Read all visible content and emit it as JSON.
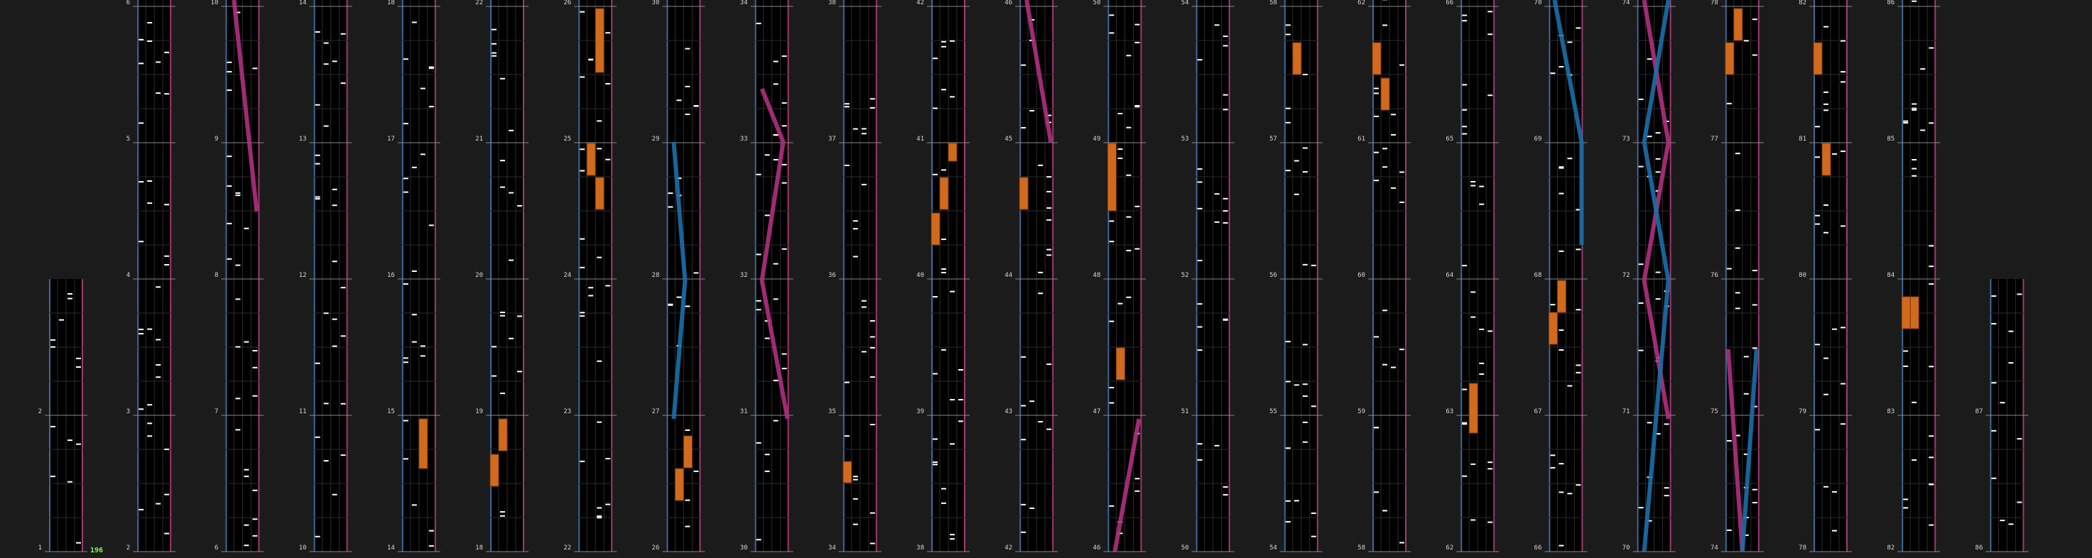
{
  "level_label": "196",
  "colors": {
    "background": "#1b1b1b",
    "lane_bg": "#000000",
    "lane_grid": "#2c2c2c",
    "lane_border_left": "#3d6a9a",
    "lane_border_right": "#a03a72",
    "note": "#ffffff",
    "hold": "#d26a1e",
    "slide_blue": "#1a6fa8",
    "slide_pink": "#b0307f"
  },
  "columns": [
    {
      "measures": [
        2,
        1
      ],
      "bottom": true
    },
    {
      "measures": [
        6,
        5,
        4,
        3,
        2
      ]
    },
    {
      "measures": [
        10,
        9,
        8,
        7,
        6
      ]
    },
    {
      "measures": [
        14,
        13,
        12,
        11,
        10
      ]
    },
    {
      "measures": [
        18,
        17,
        16,
        15,
        14
      ]
    },
    {
      "measures": [
        22,
        21,
        20,
        19,
        18
      ]
    },
    {
      "measures": [
        26,
        25,
        24,
        23,
        22
      ]
    },
    {
      "measures": [
        30,
        29,
        28,
        27,
        26
      ]
    },
    {
      "measures": [
        34,
        33,
        32,
        31,
        30
      ]
    },
    {
      "measures": [
        38,
        37,
        36,
        35,
        34
      ]
    },
    {
      "measures": [
        42,
        41,
        40,
        39,
        38
      ]
    },
    {
      "measures": [
        46,
        45,
        44,
        43,
        42
      ]
    },
    {
      "measures": [
        50,
        49,
        48,
        47,
        46
      ]
    },
    {
      "measures": [
        54,
        53,
        52,
        51,
        50
      ]
    },
    {
      "measures": [
        58,
        57,
        56,
        55,
        54
      ]
    },
    {
      "measures": [
        62,
        61,
        60,
        59,
        58
      ]
    },
    {
      "measures": [
        66,
        65,
        64,
        63,
        62
      ]
    },
    {
      "measures": [
        70,
        69,
        68,
        67,
        66
      ]
    },
    {
      "measures": [
        74,
        73,
        72,
        71,
        70
      ]
    },
    {
      "measures": [
        78,
        77,
        76,
        75,
        74
      ]
    },
    {
      "measures": [
        82,
        81,
        80,
        79,
        78
      ]
    },
    {
      "measures": [
        86,
        85,
        84,
        83,
        82
      ]
    },
    {
      "measures": [
        87,
        86
      ],
      "bottom": true
    }
  ]
}
